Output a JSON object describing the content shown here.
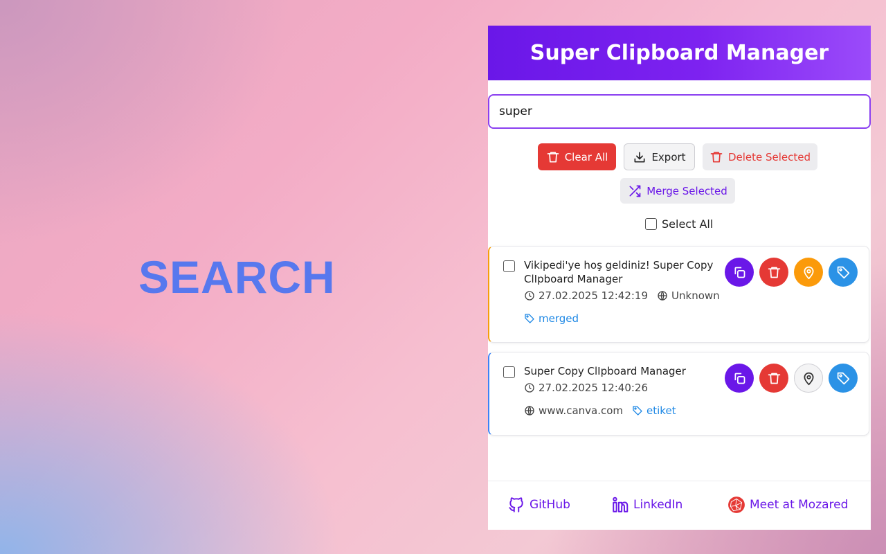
{
  "hero": {
    "text": "SEARCH"
  },
  "app": {
    "title": "Super Clipboard Manager"
  },
  "search": {
    "value": "super"
  },
  "toolbar": {
    "clear_all": "Clear All",
    "export": "Export",
    "delete_selected": "Delete Selected",
    "merge_selected": "Merge Selected",
    "select_all": "Select All"
  },
  "items": [
    {
      "text": "Vikipedi'ye hoş geldiniz! Super Copy ClIpboard Manager",
      "timestamp": "27.02.2025 12:42:19",
      "source": "Unknown",
      "tag": "merged",
      "pinned": true
    },
    {
      "text": "Super Copy ClIpboard Manager",
      "timestamp": "27.02.2025 12:40:26",
      "source": "www.canva.com",
      "tag": "etiket",
      "pinned": false
    }
  ],
  "footer": {
    "github": "GitHub",
    "linkedin": "LinkedIn",
    "mozared": "Meet at Mozared"
  },
  "colors": {
    "primary": "#6a17e8",
    "danger": "#e53935",
    "pin": "#fb9a0a",
    "tag": "#2b92e6",
    "hero": "#5778ee"
  }
}
